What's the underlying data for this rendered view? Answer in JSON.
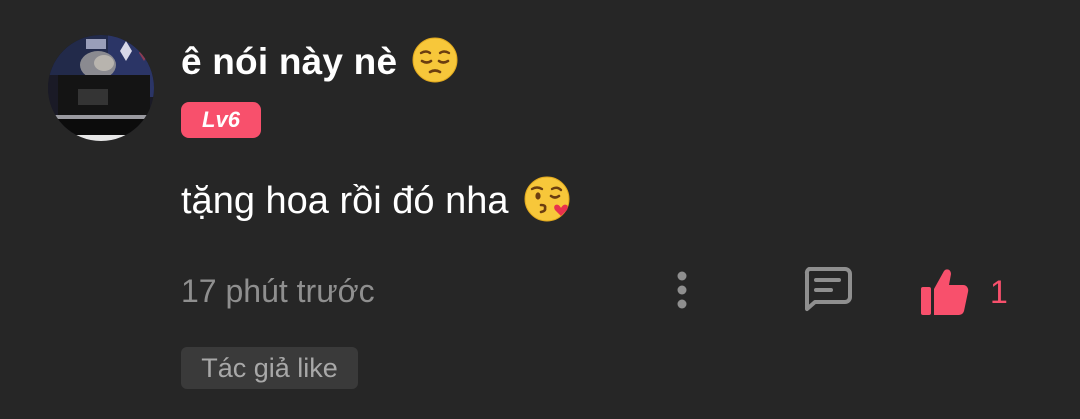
{
  "comment": {
    "username": "ê nói này nè",
    "username_emoji": "pensive-face-emoji",
    "level_badge": "Lv6",
    "text": "tặng hoa rồi đó nha",
    "text_emoji": "face-blowing-a-kiss-emoji",
    "timestamp": "17 phút trước",
    "like_count": "1",
    "author_like_label": "Tác giả like"
  },
  "icons": {
    "more": "more-vertical-icon",
    "reply": "comment-icon",
    "like": "thumbs-up-icon"
  },
  "colors": {
    "background": "#262626",
    "accent": "#f8506c",
    "muted_text": "#8f8f8f",
    "badge_bg": "#3a3a3a"
  }
}
